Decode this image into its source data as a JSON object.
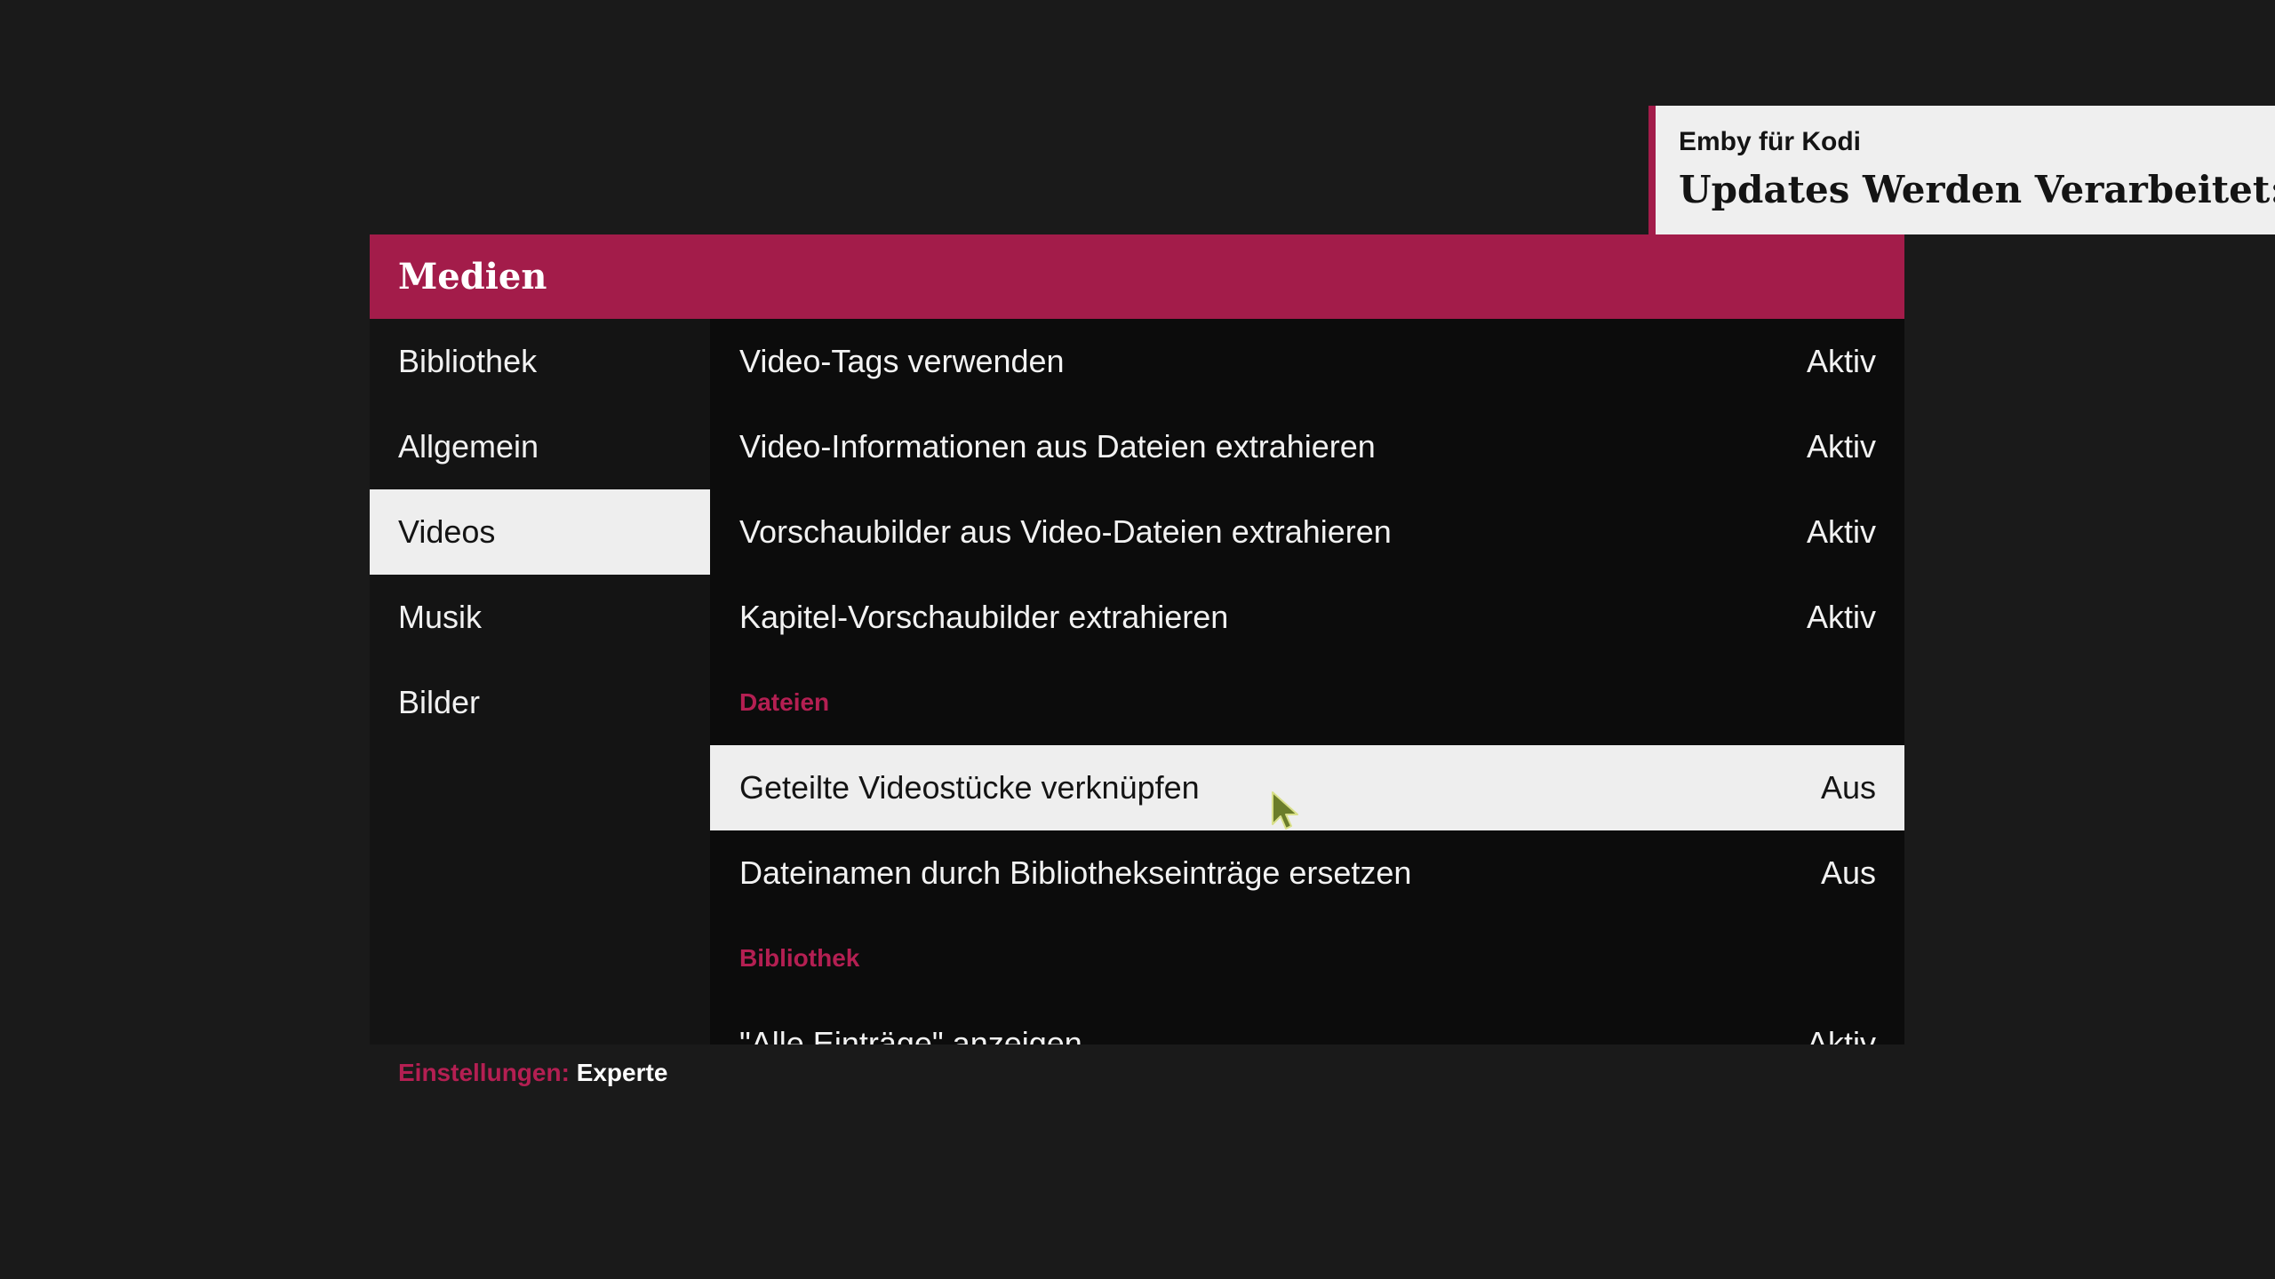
{
  "dialog": {
    "title": "Medien"
  },
  "sidebar": {
    "categories": [
      {
        "label": "Bibliothek"
      },
      {
        "label": "Allgemein"
      },
      {
        "label": "Videos"
      },
      {
        "label": "Musik"
      },
      {
        "label": "Bilder"
      }
    ],
    "selected_category": "Videos",
    "settings_level_label": "Einstellungen:",
    "settings_level_value": "Experte"
  },
  "settings": {
    "rows": [
      {
        "name": "Video-Tags verwenden",
        "value": "Aktiv"
      },
      {
        "name": "Video-Informationen aus Dateien extrahieren",
        "value": "Aktiv"
      },
      {
        "name": "Vorschaubilder aus Video-Dateien extrahieren",
        "value": "Aktiv"
      },
      {
        "name": "Kapitel-Vorschaubilder extrahieren",
        "value": "Aktiv"
      }
    ],
    "section_files": "Dateien",
    "files_rows": [
      {
        "name": "Geteilte Videostücke verknüpfen",
        "value": "Aus"
      },
      {
        "name": "Dateinamen durch Bibliothekseinträge ersetzen",
        "value": "Aus"
      }
    ],
    "section_library": "Bibliothek",
    "library_rows": [
      {
        "name": "\"Alle Einträge\" anzeigen",
        "value": "Aktiv"
      }
    ],
    "focused_setting": "Geteilte Videostücke verknüpfen"
  },
  "notification": {
    "title": "Emby für Kodi",
    "message": "Updates Werden Verarbeitet: A"
  },
  "colors": {
    "accent": "#a31c4a",
    "background": "#1a1a1a",
    "panel": "#0c0c0c",
    "highlight": "#eeeeee"
  },
  "icons": {
    "cursor": "mouse-pointer-icon"
  }
}
